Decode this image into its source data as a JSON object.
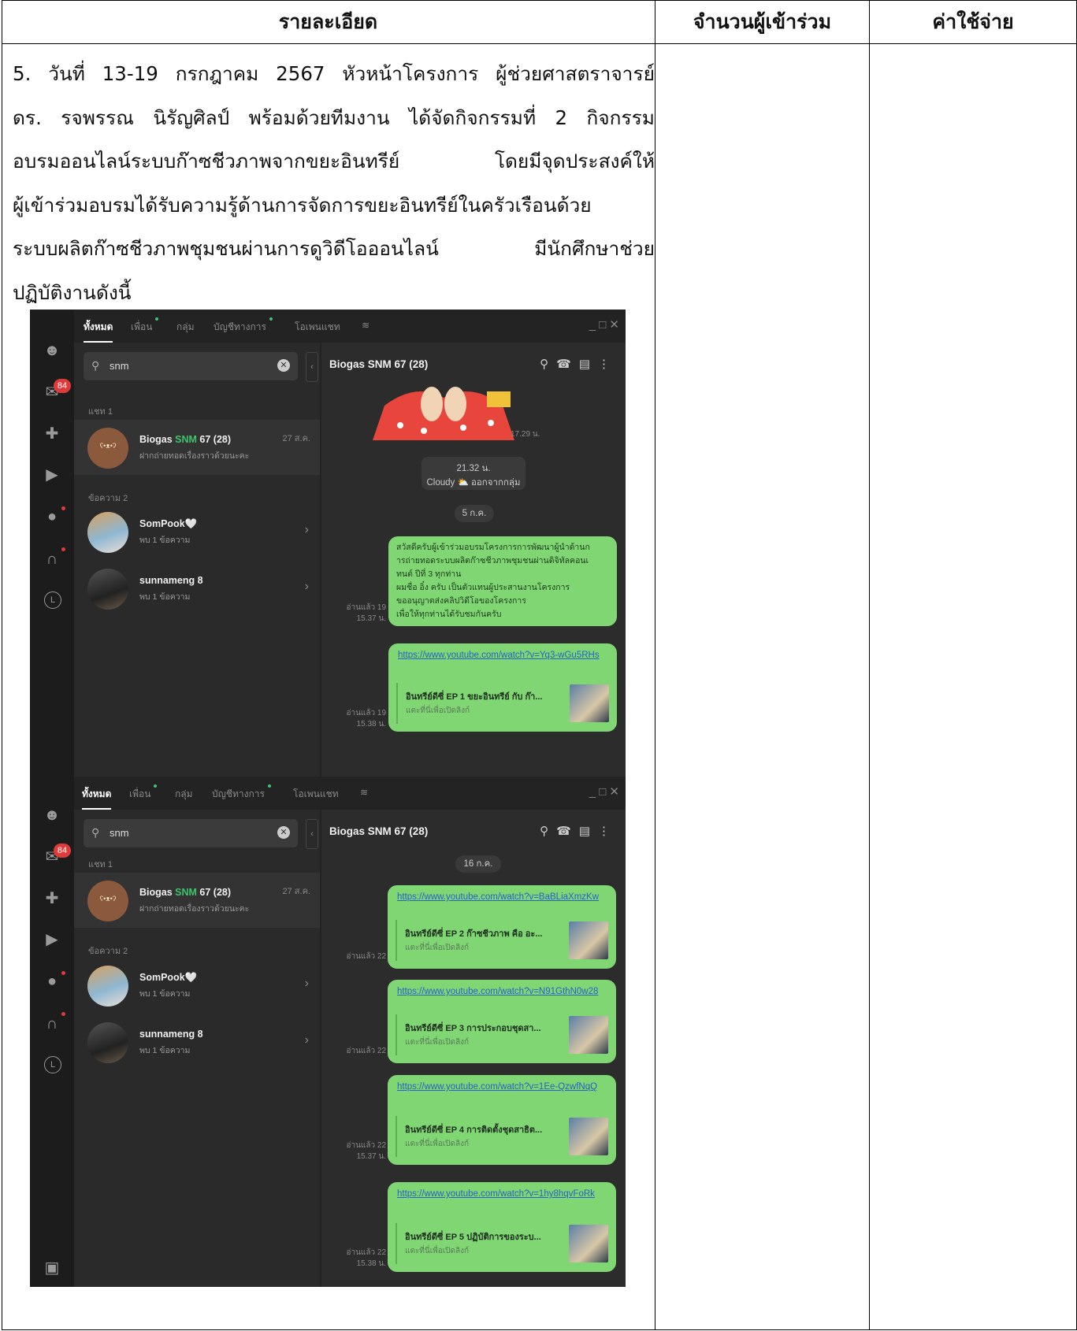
{
  "table": {
    "headers": [
      "รายละเอียด",
      "จำนวนผู้เข้าร่วม",
      "ค่าใช้จ่าย"
    ],
    "paragraph_lines": [
      "5. วันที่ 13-19 กรกฎาคม 2567 หัวหน้าโครงการ ผู้ช่วยศาสตราจารย์",
      "ดร. รจพรรณ นิรัญศิลป์ พร้อมด้วยทีมงาน ได้จัดกิจกรรมที่ 2 กิจกรรม",
      "อบรมออนไลน์ระบบก๊าซชีวภาพจากขยะอินทรีย์ โดยมีจุดประสงค์ให้",
      "ผู้เข้าร่วมอบรมได้รับความรู้ด้านการจัดการขยะอินทรีย์ในครัวเรือนด้วย",
      "ระบบผลิตก๊าซชีวภาพชุมชนผ่านการดูวิดีโอออนไลน์ มีนักศึกษาช่วย",
      "ปฏิบัติงานดังนี้"
    ]
  },
  "line_app": {
    "tabs": [
      "ทั้งหมด",
      "เพื่อน",
      "กลุ่ม",
      "บัญชีทางการ",
      "โอเพนแชท"
    ],
    "badge_count": "84",
    "search_value": "snm",
    "section_chat": "แชท 1",
    "section_messages": "ข้อความ 2",
    "chat_row": {
      "name_pre": "Biogas ",
      "name_hl": "SNM",
      "name_post": " 67 (28)",
      "sub": "ฝากถ่ายทอดเรื่องราวด้วยนะคะ",
      "date": "27 ส.ค."
    },
    "msg_rows": [
      {
        "name": "SomPook🤍",
        "sub": "พบ 1 ข้อความ"
      },
      {
        "name": "sunnameng 8",
        "sub": "พบ 1 ข้อความ"
      }
    ],
    "chat_title": "Biogas SNM 67 (28)",
    "preview_sub": "แตะที่นี่เพื่อเปิดลิงก์"
  },
  "screen1": {
    "sticker_time": "17.29 น.",
    "system_time": "21.32 น.",
    "system_text": "Cloudy ⛅ ออกจากกลุ่ม",
    "date_pill": "5 ก.ค.",
    "message_lines": [
      "สวัสดีครับผู้เข้าร่วมอบรมโครงการการพัฒนาผู้นำด้านก",
      "ารถ่ายทอดระบบผลิตก๊าซชีวภาพชุมชนผ่านดิจิทัลคอนเ",
      "ทนต์ ปีที่ 3 ทุกท่าน",
      "ผมชื่อ อิ๋ง ครับ เป็นตัวแทนผู้ประสานงานโครงการ",
      "ขออนุญาตส่งคลิปวิดีโอของโครงการ",
      "เพื่อให้ทุกท่านได้รับชมกันครับ"
    ],
    "msg_read": "อ่านแล้ว 19",
    "msg_time": "15.37 น.",
    "link_url": "https://www.youtube.com/watch?v=Yq3-wGu5RHs",
    "link_title": "อินทรีย์ดีซี่  EP 1 ขยะอินทรีย์ กับ ก๊า...",
    "link_read": "อ่านแล้ว 19",
    "link_time": "15.38 น."
  },
  "screen2": {
    "date_pill": "16 ก.ค.",
    "links": [
      {
        "url": "https://www.youtube.com/watch?v=BaBLiaXmzKw",
        "title": "อินทรีย์ดีซี่  EP 2 ก๊าซชีวภาพ คือ อะ...",
        "read": "อ่านแล้ว 22",
        "time": ""
      },
      {
        "url": "https://www.youtube.com/watch?v=N91GthN0w28",
        "title": "อินทรีย์ดีซี่  EP 3 การประกอบชุดสา...",
        "read": "อ่านแล้ว 22",
        "time": ""
      },
      {
        "url": "https://www.youtube.com/watch?v=1Ee-QzwfNqQ",
        "title": "อินทรีย์ดีซี่  EP 4 การติดตั้งชุดสาธิต...",
        "read": "อ่านแล้ว 22",
        "time": "15.37 น."
      },
      {
        "url": "https://www.youtube.com/watch?v=1hy8hqvFoRk",
        "title": "อินทรีย์ดีซี่  EP 5 ปฏิบัติการของระบ...",
        "read": "อ่านแล้ว 22",
        "time": "15.38 น."
      }
    ]
  }
}
